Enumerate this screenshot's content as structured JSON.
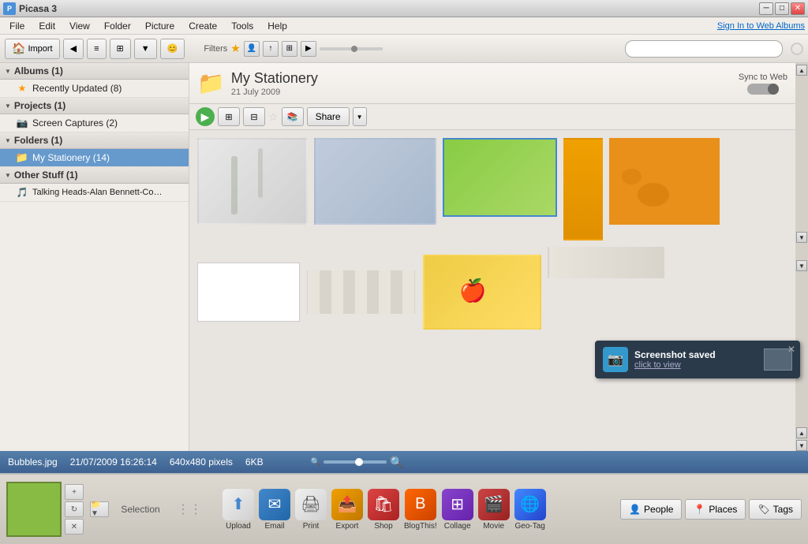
{
  "titleBar": {
    "appName": "Picasa 3",
    "icon": "P",
    "controls": {
      "minimize": "─",
      "maximize": "□",
      "close": "✕"
    }
  },
  "menuBar": {
    "items": [
      "File",
      "Edit",
      "View",
      "Folder",
      "Picture",
      "Create",
      "Tools",
      "Help"
    ],
    "signIn": "Sign In to Web Albums"
  },
  "toolbar": {
    "import": "Import",
    "filters": "Filters",
    "searchPlaceholder": ""
  },
  "sidebar": {
    "albums": {
      "label": "Albums (1)",
      "count": 1
    },
    "recentlyUpdated": {
      "label": "Recently Updated (8)",
      "count": 8
    },
    "projects": {
      "label": "Projects (1)",
      "count": 1
    },
    "screenCaptures": {
      "label": "Screen Captures (2)",
      "count": 2
    },
    "folders": {
      "label": "Folders (1)",
      "count": 1
    },
    "myStationery": {
      "label": "My Stationery (14)",
      "count": 14
    },
    "otherStuff": {
      "label": "Other Stuff (1)",
      "count": 1
    },
    "talkingHeads": {
      "label": "Talking Heads-Alan Bennett-Com...",
      "count": null
    }
  },
  "contentHeader": {
    "folderName": "My Stationery",
    "folderDate": "21 July 2009",
    "syncLabel": "Sync to Web"
  },
  "contentToolbar": {
    "shareLabel": "Share"
  },
  "statusBar": {
    "filename": "Bubbles.jpg",
    "datetime": "21/07/2009 16:26:14",
    "dimensions": "640x480 pixels",
    "filesize": "6KB"
  },
  "bottomBar": {
    "selectionLabel": "Selection",
    "buttons": {
      "upload": "Upload",
      "email": "Email",
      "print": "Print",
      "export": "Export",
      "shop": "Shop",
      "blogThis": "BlogThis!",
      "collage": "Collage",
      "movie": "Movie",
      "geoTag": "Geo-Tag"
    },
    "peopleLabel": "People",
    "placesLabel": "Places",
    "tagsLabel": "Tags"
  },
  "toast": {
    "title": "Screenshot saved",
    "subtitle": "click to view"
  }
}
